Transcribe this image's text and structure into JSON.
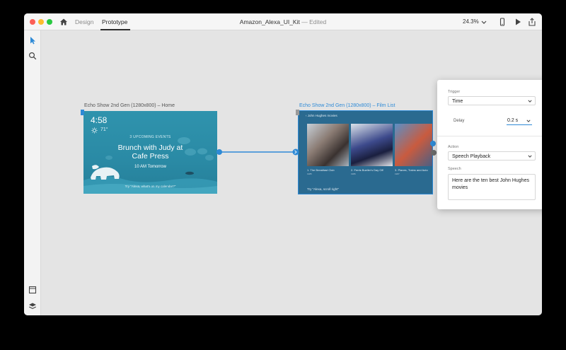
{
  "titlebar": {
    "mode_design": "Design",
    "mode_prototype": "Prototype",
    "document_name": "Amazon_Alexa_UI_Kit",
    "separator": "—",
    "status": "Edited",
    "zoom": "24.3%"
  },
  "icons": {
    "home": "home-icon",
    "device_preview": "phone-icon",
    "play": "play-icon",
    "share": "share-icon",
    "select_tool": "arrow-pointer-icon",
    "zoom_tool": "magnifier-icon",
    "assets": "assets-panel-icon",
    "layers": "layers-icon"
  },
  "artboards": [
    {
      "label": "Echo Show 2nd Gen (1280x800) – Home",
      "time": "4:58",
      "temperature": "71°",
      "events": "3 UPCOMING EVENTS",
      "headline_line1": "Brunch with Judy at",
      "headline_line2": "Cafe Press",
      "when": "10 AM Tomorrow",
      "hint": "Try \"Alexa, what's on my calendar?\""
    },
    {
      "label": "Echo Show 2nd Gen (1280x800) – Film List",
      "header": "‹  John Hughes movies",
      "films": [
        {
          "title": "1. The Breakfast Club",
          "year": "1985"
        },
        {
          "title": "2. Ferris Bueller's Day Off",
          "year": "1986"
        },
        {
          "title": "3. Planes, Trains and Auto",
          "year": "1987"
        }
      ],
      "hint": "Try \"Alexa, scroll right\""
    }
  ],
  "panel": {
    "trigger_label": "Trigger",
    "trigger_value": "Time",
    "delay_label": "Delay",
    "delay_value": "0.2 s",
    "action_label": "Action",
    "action_value": "Speech Playback",
    "speech_label": "Speech",
    "speech_text": "Here are the ten best John Hughes movies"
  },
  "colors": {
    "accent": "#2e8ad6",
    "artboard_teal": "#2a8aa5",
    "artboard_navy": "#2a6a90"
  }
}
